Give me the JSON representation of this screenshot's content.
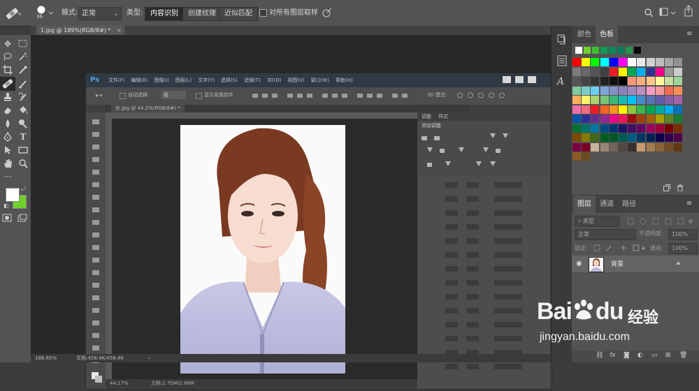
{
  "options_bar": {
    "brush_size": "36",
    "mode_label": "模式:",
    "mode_value": "正常",
    "type_label": "类型:",
    "type_options": [
      "内容识别",
      "创建纹理",
      "近似匹配"
    ],
    "selected_type": "内容识别",
    "sample_all_layers": "对所有图层取样"
  },
  "document_tab": {
    "title": "1.jpg @ 189%(RGB/8#) *"
  },
  "inner_window": {
    "ps_logo": "Ps",
    "menu": [
      "文件(F)",
      "编辑(E)",
      "图像(I)",
      "图层(L)",
      "文字(Y)",
      "选择(S)",
      "滤镜(T)",
      "3D(D)",
      "视图(V)",
      "窗口(W)",
      "帮助(H)"
    ],
    "auto_select": "自动选择:",
    "auto_select_value": "组",
    "show_transform": "显示变换控件",
    "mode_3d": "3D 模式:",
    "doc_tab": "女.jpg @ 44.2%(RGB/8#) *",
    "panel_tabs": [
      "调整",
      "样式"
    ],
    "add_adjustment": "添加调整",
    "zoom": "44.17%",
    "doc_info": "文档:2.75M/2.68M"
  },
  "status_bar": {
    "zoom": "188.65%",
    "doc_info": "文档:458.4K/458.4K"
  },
  "swatches_panel": {
    "tabs": [
      "颜色",
      "色板"
    ],
    "active_tab": "色板",
    "recent": [
      "#ffffff",
      "#6ed22b",
      "#3ebd32",
      "#0f9a54",
      "#0f8a5a",
      "#0c7b5c",
      "#23944a",
      "#0a0a0a"
    ],
    "rows": [
      [
        "#ff0000",
        "#ffff00",
        "#00ff00",
        "#00ffff",
        "#0000ff",
        "#ff00ff",
        "#ffffff",
        "#e8e8e8",
        "#d2d2d2",
        "#bcbcbc",
        "#a6a6a6",
        "#909090"
      ],
      [
        "#7c7c7c",
        "#686868",
        "#545454",
        "#404040",
        "#ed1c24",
        "#fff200",
        "#00a651",
        "#00aeef",
        "#2e3192",
        "#ec008c",
        "#999999",
        "#cccccc"
      ],
      [
        "#555555",
        "#444444",
        "#333333",
        "#222222",
        "#111111",
        "#000000",
        "#f7977a",
        "#f9ad81",
        "#fdc68a",
        "#fff79a",
        "#c4df9b",
        "#a2d39c"
      ],
      [
        "#82ca9d",
        "#7bcdc8",
        "#6ecff6",
        "#7ea7d8",
        "#8493ca",
        "#8882be",
        "#a187be",
        "#bc8dbf",
        "#f49ac2",
        "#f6989d",
        "#f26c4f",
        "#f68e55"
      ],
      [
        "#fbaf5d",
        "#fff568",
        "#acd372",
        "#7cc576",
        "#3bb878",
        "#1abbb4",
        "#00bff3",
        "#438ccb",
        "#5574b9",
        "#605ca8",
        "#855fa8",
        "#a763a8"
      ],
      [
        "#f06ea9",
        "#f26d7d",
        "#ed1c24",
        "#f26522",
        "#f7941d",
        "#fff200",
        "#8dc63f",
        "#39b54a",
        "#00a651",
        "#00a99d",
        "#00aeef",
        "#0072bc"
      ],
      [
        "#0054a6",
        "#2e3192",
        "#662d91",
        "#92278f",
        "#ec008c",
        "#ed145b",
        "#9e0b0f",
        "#a0410d",
        "#a36209",
        "#aba000",
        "#598527",
        "#1a7b30"
      ],
      [
        "#007236",
        "#00746b",
        "#0076a3",
        "#004b80",
        "#003471",
        "#1b1464",
        "#440e62",
        "#630460",
        "#9e005d",
        "#9e0039",
        "#790000",
        "#7b2e00"
      ],
      [
        "#7d4900",
        "#827b00",
        "#406618",
        "#005e20",
        "#005826",
        "#005952",
        "#005b7f",
        "#003663",
        "#002157",
        "#0d004c",
        "#32004b",
        "#4b0049"
      ],
      [
        "#7b0046",
        "#7a0026",
        "#c7b299",
        "#998675",
        "#736357",
        "#534741",
        "#37302d",
        "#c69c6d",
        "#a67c52",
        "#8c6239",
        "#754c24",
        "#603913"
      ],
      [
        "#8c5b25",
        "#6b4a1f"
      ]
    ]
  },
  "layers_panel": {
    "tabs": [
      "图层",
      "通道",
      "路径"
    ],
    "active_tab": "图层",
    "filter_label": "类型",
    "blend_mode": "正常",
    "opacity_label": "不透明度:",
    "opacity_value": "100%",
    "lock_label": "锁定:",
    "fill_label": "填充:",
    "fill_value": "100%",
    "layer_name": "背景"
  },
  "watermark": {
    "brand": "Bai",
    "brand_suffix": "du",
    "product": "经验",
    "url": "jingyan.baidu.com"
  }
}
